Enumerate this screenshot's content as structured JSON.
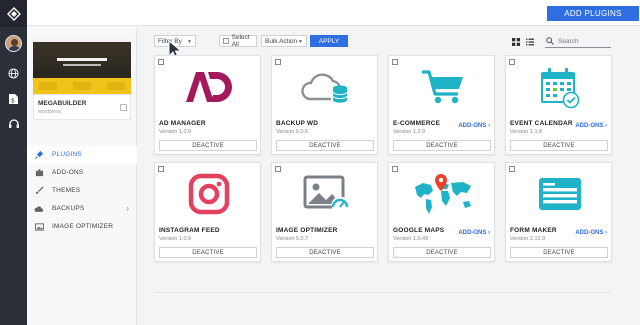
{
  "topbar": {
    "add_plugins_label": "ADD PLUGINS"
  },
  "site": {
    "name": "MEGABUILDER",
    "subtitle": "wordpress"
  },
  "sidebar": {
    "items": [
      {
        "label": "PLUGINS",
        "icon": "plug-icon",
        "active": true
      },
      {
        "label": "ADD-ONS",
        "icon": "puzzle-icon",
        "active": false
      },
      {
        "label": "THEMES",
        "icon": "brush-icon",
        "active": false
      },
      {
        "label": "BACKUPS",
        "icon": "cloud-icon",
        "active": false,
        "has_chevron": true
      },
      {
        "label": "IMAGE OPTIMIZER",
        "icon": "image-icon",
        "active": false
      }
    ]
  },
  "toolbar": {
    "filter_label": "Filter By",
    "select_all_label": "Select All",
    "bulk_action_label": "Bulk Action",
    "apply_label": "APPLY",
    "search_placeholder": "Search"
  },
  "plugins": [
    {
      "name": "AD MANAGER",
      "version": "Version 1.0.9",
      "addons": "",
      "action": "DEACTIVE",
      "icon": "ad-manager-icon"
    },
    {
      "name": "BACKUP WD",
      "version": "Version 5.0.6",
      "addons": "",
      "action": "DEACTIVE",
      "icon": "cloud-database-icon"
    },
    {
      "name": "E-COMMERCE",
      "version": "Version 1.2.9",
      "addons": "ADD-ONS ›",
      "action": "DEACTIVE",
      "icon": "shopping-cart-icon"
    },
    {
      "name": "EVENT CALENDAR",
      "version": "Version 1.1.8",
      "addons": "ADD-ONS ›",
      "action": "DEACTIVE",
      "icon": "calendar-icon"
    },
    {
      "name": "INSTAGRAM FEED",
      "version": "Version 1.0.9",
      "addons": "",
      "action": "DEACTIVE",
      "icon": "instagram-icon"
    },
    {
      "name": "IMAGE OPTIMIZER",
      "version": "Version 5.0.7",
      "addons": "",
      "action": "DEACTIVE",
      "icon": "image-optimizer-icon"
    },
    {
      "name": "GOOGLE MAPS",
      "version": "Version 1.0.49",
      "addons": "ADD-ONS ›",
      "action": "DEACTIVE",
      "icon": "world-map-icon"
    },
    {
      "name": "FORM MAKER",
      "version": "Version 2.12.9",
      "addons": "ADD-ONS ›",
      "action": "DEACTIVE",
      "icon": "form-icon"
    }
  ],
  "colors": {
    "accent": "#2f6ee0",
    "rail": "#2b2f38",
    "ad": "#a3195b",
    "instagram": "#e4405f",
    "teal": "#1fb3c7"
  }
}
